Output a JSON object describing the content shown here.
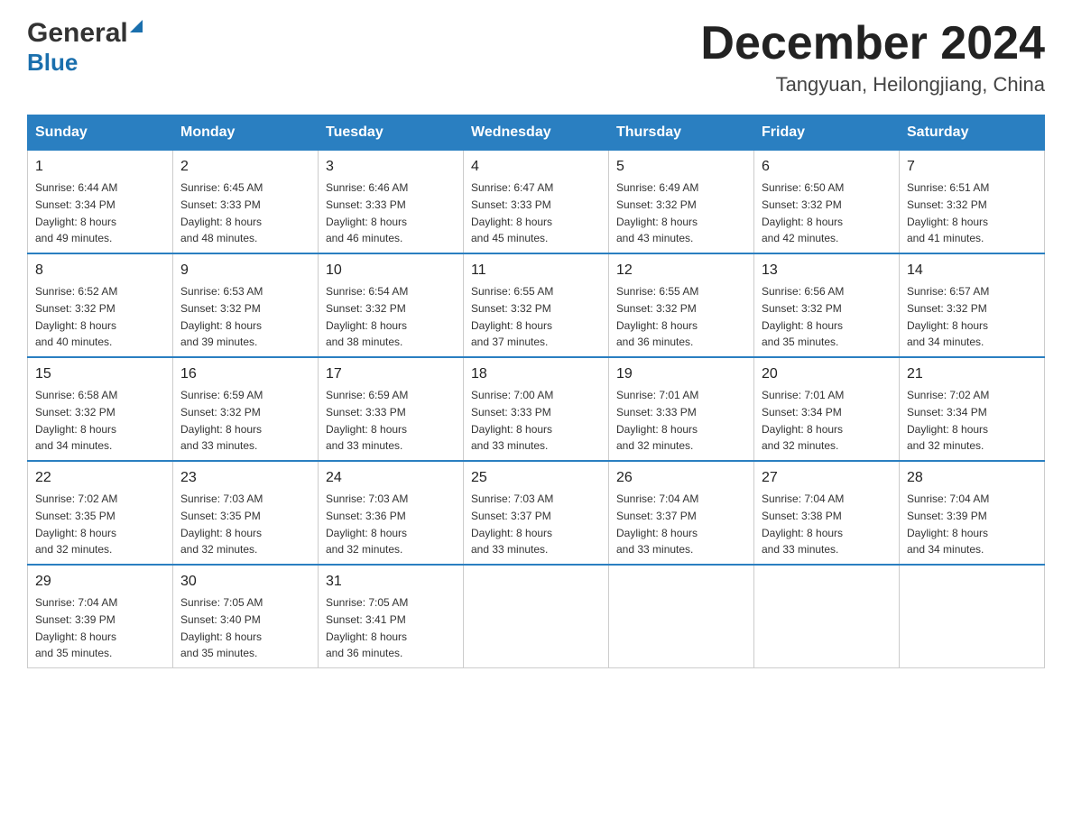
{
  "header": {
    "logo_general": "General",
    "logo_blue": "Blue",
    "month_title": "December 2024",
    "location": "Tangyuan, Heilongjiang, China"
  },
  "days_of_week": [
    "Sunday",
    "Monday",
    "Tuesday",
    "Wednesday",
    "Thursday",
    "Friday",
    "Saturday"
  ],
  "weeks": [
    [
      {
        "num": "1",
        "sunrise": "6:44 AM",
        "sunset": "3:34 PM",
        "daylight": "8 hours and 49 minutes."
      },
      {
        "num": "2",
        "sunrise": "6:45 AM",
        "sunset": "3:33 PM",
        "daylight": "8 hours and 48 minutes."
      },
      {
        "num": "3",
        "sunrise": "6:46 AM",
        "sunset": "3:33 PM",
        "daylight": "8 hours and 46 minutes."
      },
      {
        "num": "4",
        "sunrise": "6:47 AM",
        "sunset": "3:33 PM",
        "daylight": "8 hours and 45 minutes."
      },
      {
        "num": "5",
        "sunrise": "6:49 AM",
        "sunset": "3:32 PM",
        "daylight": "8 hours and 43 minutes."
      },
      {
        "num": "6",
        "sunrise": "6:50 AM",
        "sunset": "3:32 PM",
        "daylight": "8 hours and 42 minutes."
      },
      {
        "num": "7",
        "sunrise": "6:51 AM",
        "sunset": "3:32 PM",
        "daylight": "8 hours and 41 minutes."
      }
    ],
    [
      {
        "num": "8",
        "sunrise": "6:52 AM",
        "sunset": "3:32 PM",
        "daylight": "8 hours and 40 minutes."
      },
      {
        "num": "9",
        "sunrise": "6:53 AM",
        "sunset": "3:32 PM",
        "daylight": "8 hours and 39 minutes."
      },
      {
        "num": "10",
        "sunrise": "6:54 AM",
        "sunset": "3:32 PM",
        "daylight": "8 hours and 38 minutes."
      },
      {
        "num": "11",
        "sunrise": "6:55 AM",
        "sunset": "3:32 PM",
        "daylight": "8 hours and 37 minutes."
      },
      {
        "num": "12",
        "sunrise": "6:55 AM",
        "sunset": "3:32 PM",
        "daylight": "8 hours and 36 minutes."
      },
      {
        "num": "13",
        "sunrise": "6:56 AM",
        "sunset": "3:32 PM",
        "daylight": "8 hours and 35 minutes."
      },
      {
        "num": "14",
        "sunrise": "6:57 AM",
        "sunset": "3:32 PM",
        "daylight": "8 hours and 34 minutes."
      }
    ],
    [
      {
        "num": "15",
        "sunrise": "6:58 AM",
        "sunset": "3:32 PM",
        "daylight": "8 hours and 34 minutes."
      },
      {
        "num": "16",
        "sunrise": "6:59 AM",
        "sunset": "3:32 PM",
        "daylight": "8 hours and 33 minutes."
      },
      {
        "num": "17",
        "sunrise": "6:59 AM",
        "sunset": "3:33 PM",
        "daylight": "8 hours and 33 minutes."
      },
      {
        "num": "18",
        "sunrise": "7:00 AM",
        "sunset": "3:33 PM",
        "daylight": "8 hours and 33 minutes."
      },
      {
        "num": "19",
        "sunrise": "7:01 AM",
        "sunset": "3:33 PM",
        "daylight": "8 hours and 32 minutes."
      },
      {
        "num": "20",
        "sunrise": "7:01 AM",
        "sunset": "3:34 PM",
        "daylight": "8 hours and 32 minutes."
      },
      {
        "num": "21",
        "sunrise": "7:02 AM",
        "sunset": "3:34 PM",
        "daylight": "8 hours and 32 minutes."
      }
    ],
    [
      {
        "num": "22",
        "sunrise": "7:02 AM",
        "sunset": "3:35 PM",
        "daylight": "8 hours and 32 minutes."
      },
      {
        "num": "23",
        "sunrise": "7:03 AM",
        "sunset": "3:35 PM",
        "daylight": "8 hours and 32 minutes."
      },
      {
        "num": "24",
        "sunrise": "7:03 AM",
        "sunset": "3:36 PM",
        "daylight": "8 hours and 32 minutes."
      },
      {
        "num": "25",
        "sunrise": "7:03 AM",
        "sunset": "3:37 PM",
        "daylight": "8 hours and 33 minutes."
      },
      {
        "num": "26",
        "sunrise": "7:04 AM",
        "sunset": "3:37 PM",
        "daylight": "8 hours and 33 minutes."
      },
      {
        "num": "27",
        "sunrise": "7:04 AM",
        "sunset": "3:38 PM",
        "daylight": "8 hours and 33 minutes."
      },
      {
        "num": "28",
        "sunrise": "7:04 AM",
        "sunset": "3:39 PM",
        "daylight": "8 hours and 34 minutes."
      }
    ],
    [
      {
        "num": "29",
        "sunrise": "7:04 AM",
        "sunset": "3:39 PM",
        "daylight": "8 hours and 35 minutes."
      },
      {
        "num": "30",
        "sunrise": "7:05 AM",
        "sunset": "3:40 PM",
        "daylight": "8 hours and 35 minutes."
      },
      {
        "num": "31",
        "sunrise": "7:05 AM",
        "sunset": "3:41 PM",
        "daylight": "8 hours and 36 minutes."
      },
      null,
      null,
      null,
      null
    ]
  ],
  "labels": {
    "sunrise": "Sunrise:",
    "sunset": "Sunset:",
    "daylight": "Daylight:"
  }
}
